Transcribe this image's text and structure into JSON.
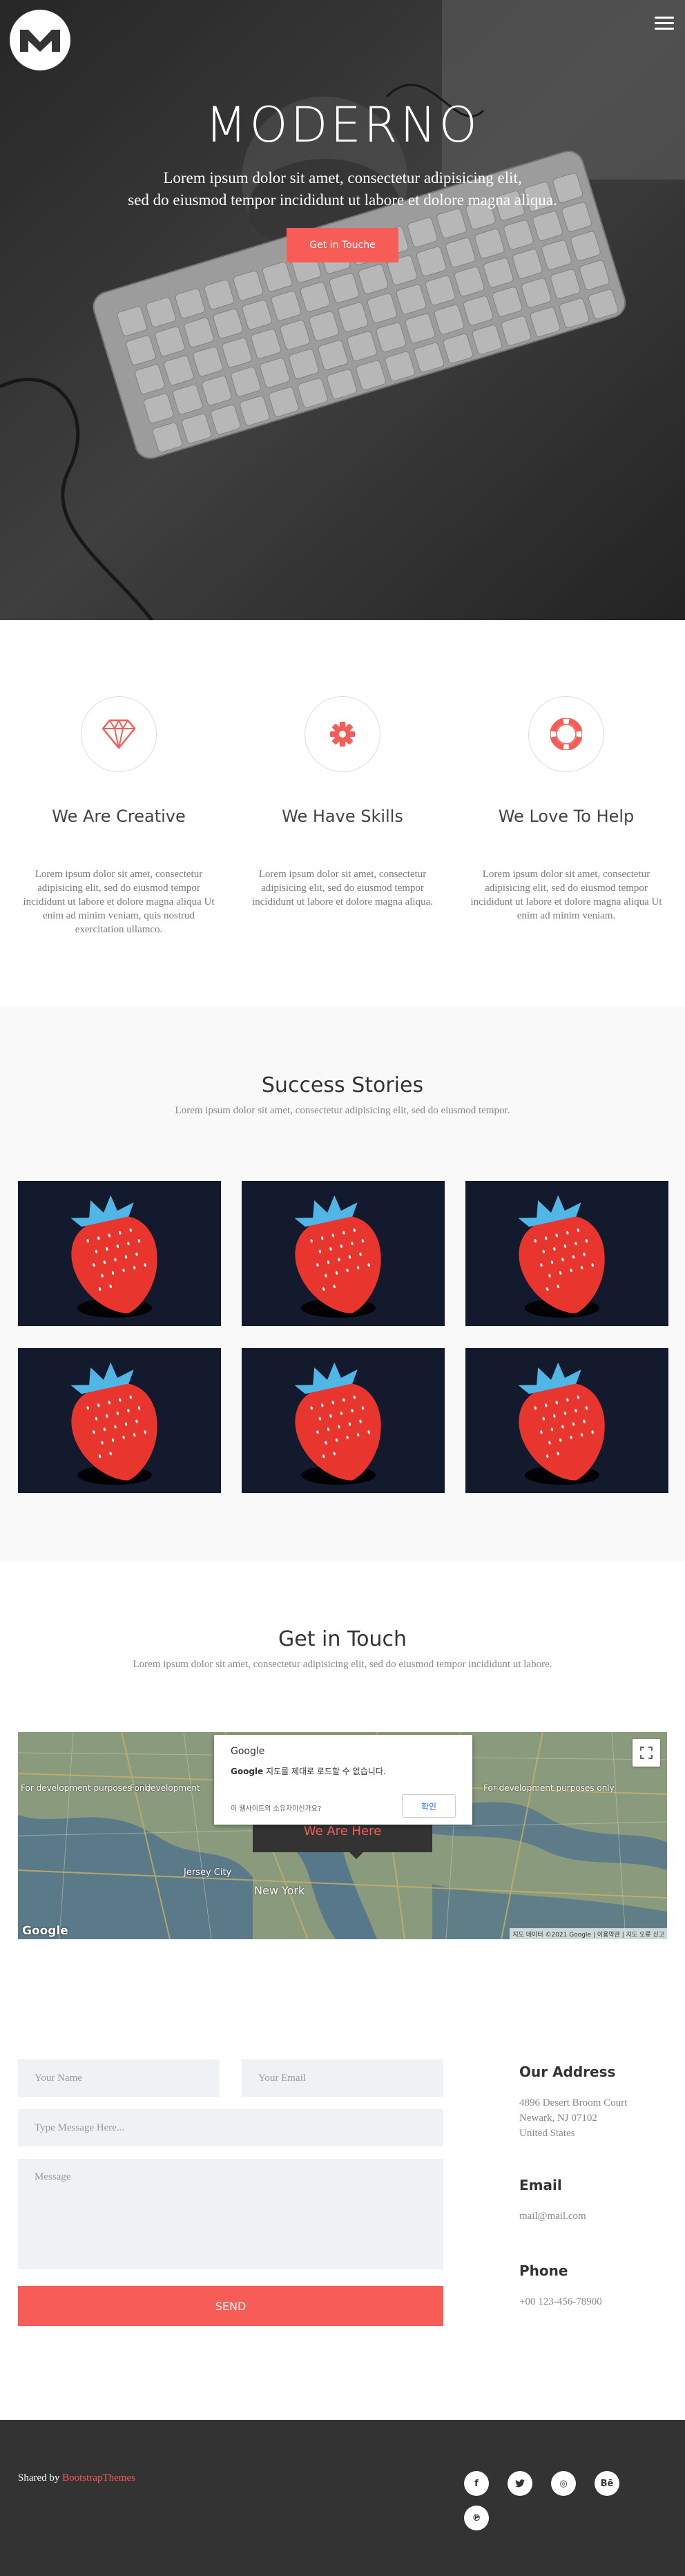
{
  "header": {
    "brand": "MODERNO",
    "tagline_line1": "Lorem ipsum dolor sit amet, consectetur adipisicing elit,",
    "tagline_line2": "sed do eiusmod tempor incididunt ut labore et dolore magna aliqua.",
    "cta_label": "Get in Touche",
    "logo_icon": "logo-m-icon",
    "menu_icon": "hamburger-menu-icon"
  },
  "features": [
    {
      "icon": "diamond-icon",
      "title": "We Are Creative",
      "text": "Lorem ipsum dolor sit amet, consectetur adipisicing elit, sed do eiusmod tempor incididunt ut labore et dolore magna aliqua Ut enim ad minim veniam, quis nostrud exercitation ullamco."
    },
    {
      "icon": "gear-icon",
      "title": "We Have Skills",
      "text": "Lorem ipsum dolor sit amet, consectetur adipisicing elit, sed do eiusmod tempor incididunt ut labore et dolore magna aliqua."
    },
    {
      "icon": "lifebuoy-icon",
      "title": "We Love To Help",
      "text": "Lorem ipsum dolor sit amet, consectetur adipisicing elit, sed do eiusmod tempor incididunt ut labore et dolore magna aliqua Ut enim ad minim veniam."
    }
  ],
  "stories": {
    "title": "Success Stories",
    "subtitle": "Lorem ipsum dolor sit amet, consectetur adipisicing elit, sed do eiusmod tempor.",
    "items": [
      "strawberry",
      "strawberry",
      "strawberry",
      "strawberry",
      "strawberry",
      "strawberry"
    ]
  },
  "contact": {
    "title": "Get in Touch",
    "subtitle": "Lorem ipsum dolor sit amet, consectetur adipisicing elit, sed do eiusmod tempor incididunt ut labore.",
    "map": {
      "dialog_brand": "Google",
      "dialog_bold": "Google",
      "dialog_message": " 지도를 제대로 로드할 수 없습니다.",
      "dialog_owner": "이 웹사이트의 소유자이신가요?",
      "dialog_ok": "확인",
      "marker_text": "We Are Here",
      "dev_left": "For development purposes only",
      "dev_mid": "For development",
      "dev_right": "For development purposes only",
      "city": "New York",
      "city_left": "Jersey City",
      "logo": "Google",
      "terms": "지도 데이터 ©2021 Google | 이용약관 | 지도 오류 신고"
    },
    "form": {
      "name_placeholder": "Your Name",
      "email_placeholder": "Your Email",
      "subject_placeholder": "Type Message Here...",
      "message_placeholder": "Message",
      "send_label": "SEND"
    },
    "info": {
      "address_title": "Our Address",
      "address_line1": "4896 Desert Broom Court",
      "address_line2": "Newark, NJ 07102",
      "address_line3": "United States",
      "email_title": "Email",
      "email_value": "mail@mail.com",
      "phone_title": "Phone",
      "phone_value": "+00 123-456-78900"
    }
  },
  "footer": {
    "credit_prefix": "Shared by ",
    "credit_link": "BootstrapThemes",
    "social": [
      {
        "icon": "facebook-icon",
        "glyph": "f"
      },
      {
        "icon": "twitter-icon",
        "glyph": "🐦"
      },
      {
        "icon": "dribbble-icon",
        "glyph": "◎"
      },
      {
        "icon": "behance-icon",
        "glyph": "Bē"
      },
      {
        "icon": "pinterest-icon",
        "glyph": "℗"
      }
    ]
  },
  "colors": {
    "accent": "#f85c56",
    "dark": "#333333",
    "gallery_bg": "#141a2e",
    "strawberry": "#e8352e",
    "leaf": "#4fb6e6"
  }
}
